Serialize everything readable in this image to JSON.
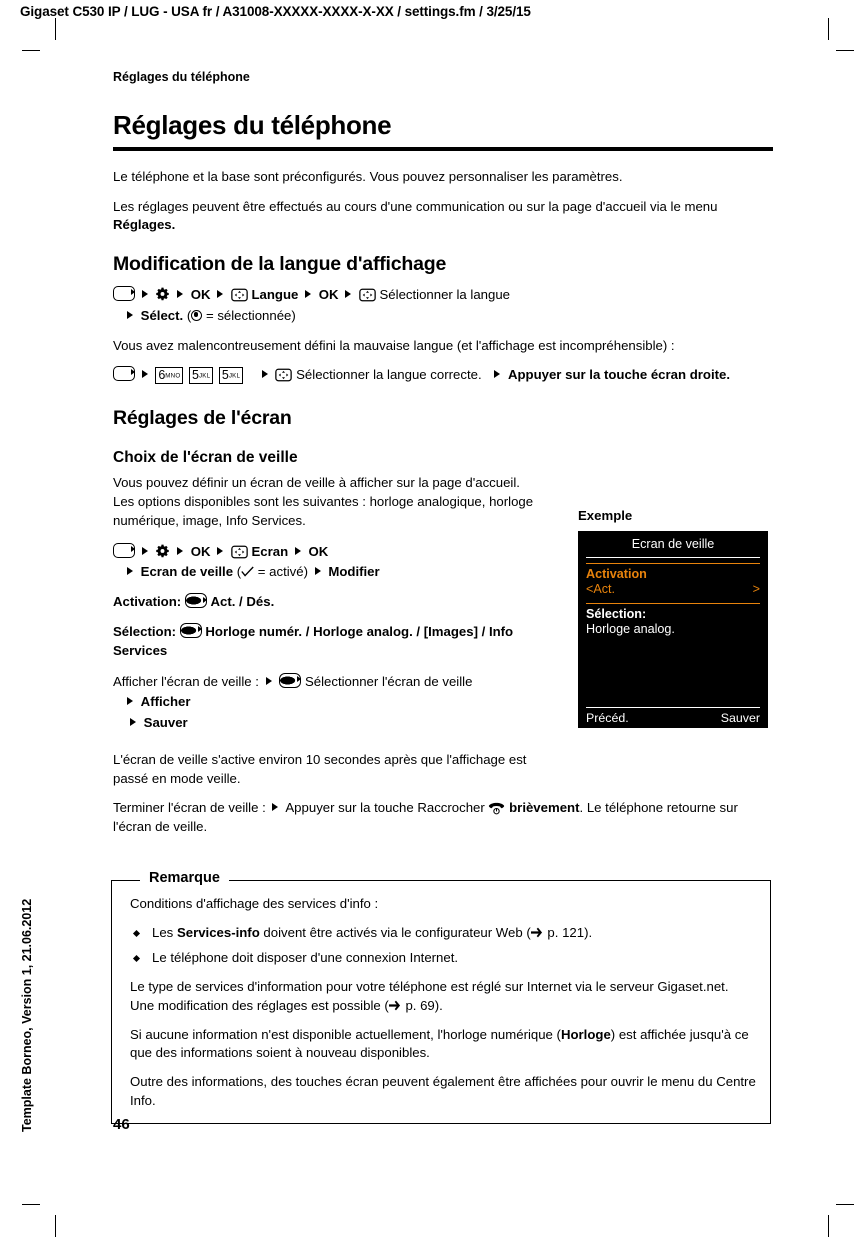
{
  "header": {
    "running_head": "Gigaset C530 IP / LUG - USA fr / A31008-XXXXX-XXXX-X-XX / settings.fm / 3/25/15"
  },
  "side_note": "Template Borneo, Version 1, 21.06.2012",
  "folio": "46",
  "chapter_marker": "Réglages du téléphone",
  "title": "Réglages du téléphone",
  "intro": {
    "p1": "Le téléphone et la base sont préconfigurés. Vous pouvez personnaliser les paramètres.",
    "p2_a": "Les réglages peuvent être effectués au cours d'une communication ou sur la page d'accueil via le menu ",
    "p2_b": "Réglages."
  },
  "language_section": {
    "heading": "Modification de la langue d'affichage",
    "step_ok1": "OK",
    "step_langue": "Langue",
    "step_ok2": "OK",
    "step_select_language": "Sélectionner la langue",
    "step_select_label": "Sélect.",
    "step_select_suffix": "= sélectionnée)",
    "wrong_language_text": "Vous avez malencontreusement défini la mauvaise langue (et l'affichage est incompréhensible) :",
    "keys": [
      {
        "num": "6",
        "letters": "MNO"
      },
      {
        "num": "5",
        "letters": "JKL"
      },
      {
        "num": "5",
        "letters": "JKL"
      }
    ],
    "step_select_correct": "Sélectionner la langue correcte.",
    "step_press_right_a": "Appuyer sur la touche écran ",
    "step_press_right_b": "droite."
  },
  "screen_section": {
    "heading": "Réglages de l'écran",
    "subheading": "Choix de l'écran de veille",
    "intro": "Vous pouvez définir un écran de veille à afficher sur la page d'accueil. Les options disponibles sont les suivantes : horloge analogique, horloge numérique, image, Info Services.",
    "step_ok1": "OK",
    "step_ecran": "Ecran",
    "step_ok2": "OK",
    "step_ecran_de_veille": "Ecran de veille",
    "step_active_suffix": "= activé)",
    "step_modifier": "Modifier",
    "activation_label": "Activation:",
    "activation_value": "Act. / Dés.",
    "selection_label": "Sélection:",
    "selection_value": "Horloge numér. / Horloge analog. / [Images] / Info Services",
    "afficher_label": "Afficher l'écran de veille :",
    "afficher_value": "Sélectionner l'écran de veille",
    "afficher_step": "Afficher",
    "sauver_step": "Sauver",
    "timing_text": "L'écran de veille s'active environ 10 secondes après que l'affichage est passé en mode veille.",
    "terminate_a": "Terminer l'écran de veille :",
    "terminate_b": "Appuyer sur la touche Raccrocher",
    "terminate_c": "brièvement",
    "terminate_d": ". Le téléphone retourne sur l'écran de veille."
  },
  "example": {
    "label": "Exemple",
    "lcd": {
      "title": "Ecran de veille",
      "field_label": "Activation",
      "value_left": "<Act.",
      "value_right": ">",
      "selection_label": "Sélection:",
      "selection_value": "Horloge analog.",
      "softkey_left": "Précéd.",
      "softkey_right": "Sauver",
      "accent_color": "#E8830C",
      "background_color": "#000000",
      "text_color": "#FFFFFF"
    }
  },
  "note": {
    "title": "Remarque",
    "intro": "Conditions d'affichage des services d'info :",
    "bullets": [
      {
        "a": "Les ",
        "b": "Services-info",
        "c": " doivent être activés via le configurateur Web (",
        "ref": "p. 121",
        "d": ")."
      },
      {
        "a": "Le téléphone doit disposer d'une connexion Internet.",
        "b": "",
        "c": "",
        "ref": "",
        "d": ""
      }
    ],
    "p1_a": "Le type de services d'information pour votre téléphone est réglé sur Internet via le serveur Gigaset.net. Une modification des réglages est possible (",
    "p1_ref": "p. 69",
    "p1_b": ").",
    "p2_a": "Si aucune information n'est disponible actuellement, l'horloge numérique (",
    "p2_b": "Horloge",
    "p2_c": ") est affichée jusqu'à ce que des informations soient à nouveau disponibles.",
    "p3": "Outre des informations, des touches écran peuvent également être affichées pour ouvrir le menu du Centre Info."
  }
}
